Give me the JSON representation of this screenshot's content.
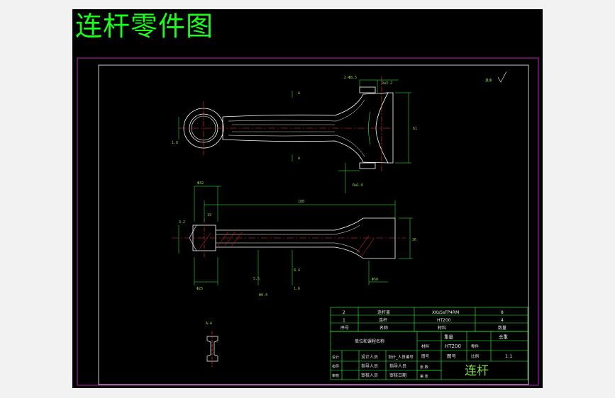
{
  "title": "连杆零件图",
  "dims": {
    "d_top": "2-Φ8.5",
    "ra_top": "Ra3.2",
    "h_right": "61",
    "d_small": "Φ32",
    "len_total": "180",
    "w_right": "36",
    "h_small": "19",
    "d_shaft": "Φ25",
    "l_mid": "5.5",
    "l_mid2": "Φ6.4",
    "l_mid3": "1.6",
    "l_mid4": "8.4",
    "d_bottom": "Φ50",
    "chamfer": "1.8",
    "section_label": "A-A",
    "other": "其余",
    "a_top": "A",
    "a_bot": "A",
    "ra_left": "3.2",
    "ra_small": "Ra1.6"
  },
  "bom": {
    "rows": [
      {
        "no": "2",
        "name": "连杆盖",
        "code": "XKsSsFP4RM",
        "material": "8"
      },
      {
        "no": "1",
        "name": "连杆",
        "code": "HT200",
        "material": "4"
      }
    ],
    "header": {
      "no": "序号",
      "name": "名称",
      "material": "材料",
      "qty": "数量"
    }
  },
  "titleblock": {
    "company": "单位和课程名称",
    "weight_label": "重量",
    "scale_label": "总重",
    "material_label": "材料",
    "material_value": "HT200",
    "part_label": "零件",
    "qty_label": "数量",
    "drawing_no_label": "图号",
    "scale_text": "比例",
    "scale_value": "1:1",
    "designer": "设计人员",
    "designer_value": "设计_人员编号",
    "guide": "指导人员",
    "guide_value": "指导人员",
    "review": "审核人员",
    "review_value": "审核日期",
    "design_short": "设计",
    "guide_short": "指导",
    "review_short": "审核",
    "drawing_label": "图号",
    "part_name": "连杆",
    "sheet_a": "张 数",
    "sheet_b": "第 张"
  }
}
